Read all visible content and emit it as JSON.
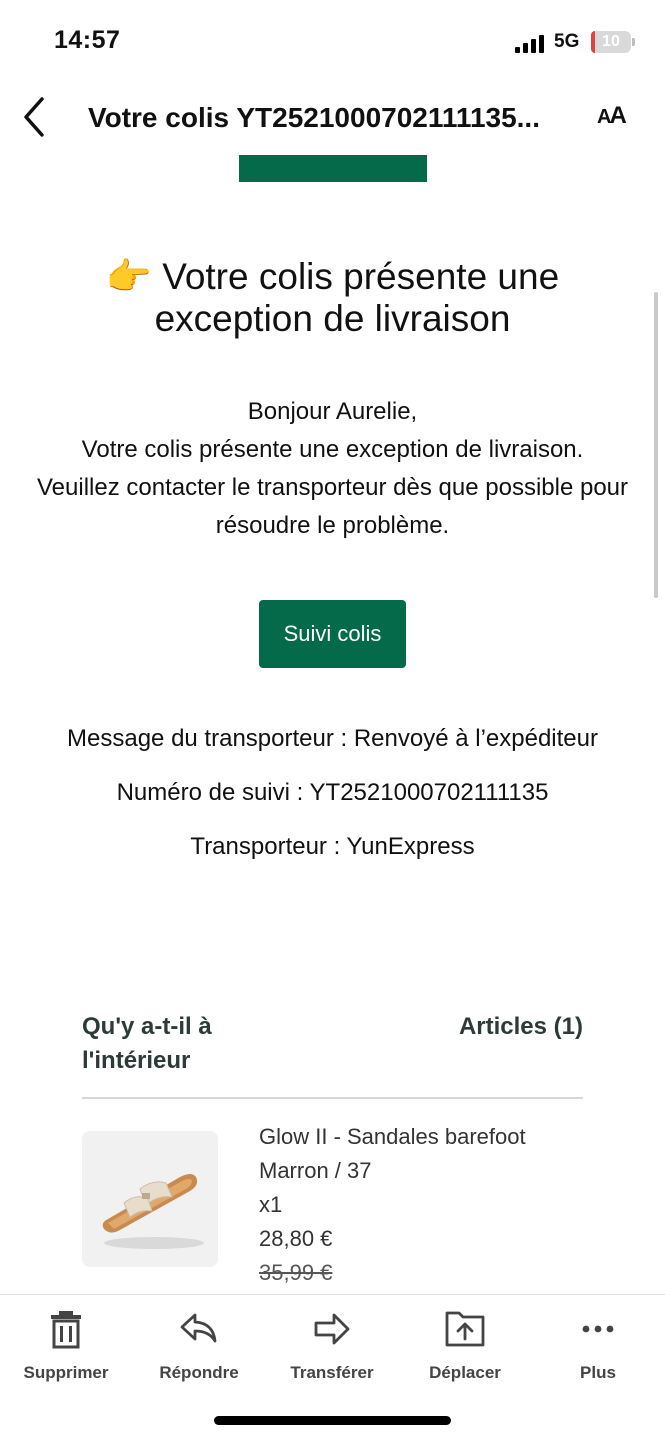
{
  "status_bar": {
    "time": "14:57",
    "network": "5G",
    "battery": "10",
    "battery_level": 0.1
  },
  "nav": {
    "title": "Votre colis YT2521000702111135...",
    "text_size_large": "A",
    "text_size_small": "A"
  },
  "email": {
    "headline_emoji": "👉",
    "headline": "Votre colis présente une exception de livraison",
    "greeting": "Bonjour Aurelie,",
    "body_line1": "Votre colis présente une exception de livraison.",
    "body_line2": "Veuillez contacter le transporteur dès que possible pour résoudre le problème.",
    "track_button": "Suivi colis",
    "carrier_message": "Message du transporteur : Renvoyé à l’expéditeur",
    "tracking_number": "Numéro de suivi : YT2521000702111135",
    "carrier": "Transporteur : YunExpress",
    "items_heading": "Qu'y a-t-il à l'intérieur",
    "items_count": "Articles (1)",
    "product": {
      "name": "Glow II - Sandales barefoot",
      "variant": "Marron / 37",
      "quantity": "x1",
      "price": "28,80 €",
      "old_price": "35,99 €"
    }
  },
  "toolbar": {
    "items": [
      {
        "label": "Supprimer",
        "icon": "trash-icon"
      },
      {
        "label": "Répondre",
        "icon": "reply-icon"
      },
      {
        "label": "Transférer",
        "icon": "forward-icon"
      },
      {
        "label": "Déplacer",
        "icon": "move-folder-icon"
      },
      {
        "label": "Plus",
        "icon": "more-icon"
      }
    ]
  },
  "colors": {
    "brand_green": "#046a49",
    "battery_low": "#e0433b"
  }
}
